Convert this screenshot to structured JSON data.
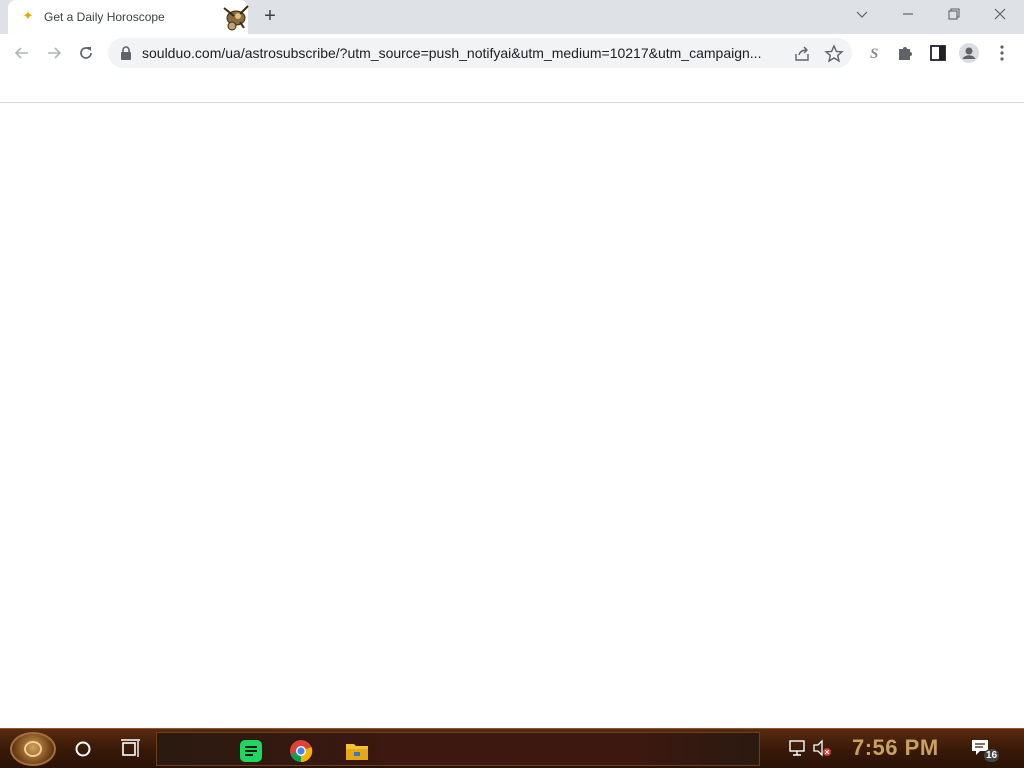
{
  "browser": {
    "tab": {
      "title": "Get a Daily Horoscope",
      "favicon": "sparkle-star-icon"
    },
    "new_tab_label": "+",
    "window_controls": [
      "chevron-down-icon",
      "minimize-icon",
      "restore-icon",
      "close-icon"
    ],
    "toolbar": {
      "back": "back-arrow-icon",
      "forward": "forward-arrow-icon",
      "reload": "reload-icon",
      "url": "soulduo.com/ua/astrosubscribe/?utm_source=push_notifyai&utm_medium=10217&utm_campaign..."
    },
    "omnibox_icons": [
      "share-icon",
      "star-icon"
    ],
    "extensions": [
      "s-extension-icon",
      "puzzle-icon",
      "side-panel-icon",
      "profile-icon",
      "kebab-menu-icon"
    ]
  },
  "taskbar": {
    "apps": [
      "cortana-icon",
      "task-view-icon",
      "notes-app-icon",
      "chrome-icon",
      "file-explorer-icon"
    ],
    "tray": [
      "network-icon",
      "volume-muted-icon"
    ],
    "clock": "7:56 PM",
    "notification_count": "16"
  },
  "colors": {
    "tabstrip_bg": "#dee1e6",
    "omnibox_bg": "#f1f3f4",
    "taskbar_bg": "#3a1a08",
    "clock_color": "#c8a060"
  }
}
